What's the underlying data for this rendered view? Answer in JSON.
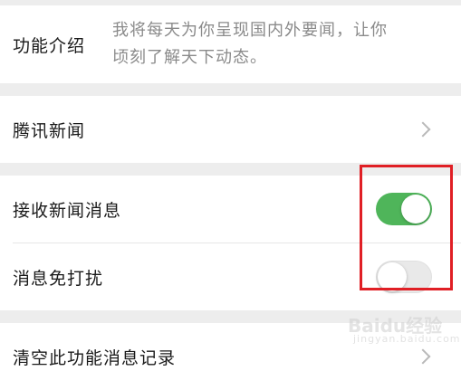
{
  "intro": {
    "label": "功能介绍",
    "text_line1": "我将每天为你呈现国内外要闻，让你",
    "text_line2": "顷刻了解天下动态。"
  },
  "publisher": {
    "label": "腾讯新闻",
    "icon": "chevron-right-icon"
  },
  "settings": {
    "receive": {
      "label": "接收新闻消息",
      "state": "on"
    },
    "dnd": {
      "label": "消息免打扰",
      "state": "off"
    }
  },
  "clear": {
    "label": "清空此功能消息记录",
    "icon": "chevron-right-icon"
  },
  "watermark": {
    "main": "Baidu经验",
    "sub": "jingyan.baidu.com"
  },
  "colors": {
    "toggle_on": "#4fb55a",
    "toggle_off": "#e9e9e9",
    "highlight": "#e01f25",
    "background": "#ededed"
  }
}
